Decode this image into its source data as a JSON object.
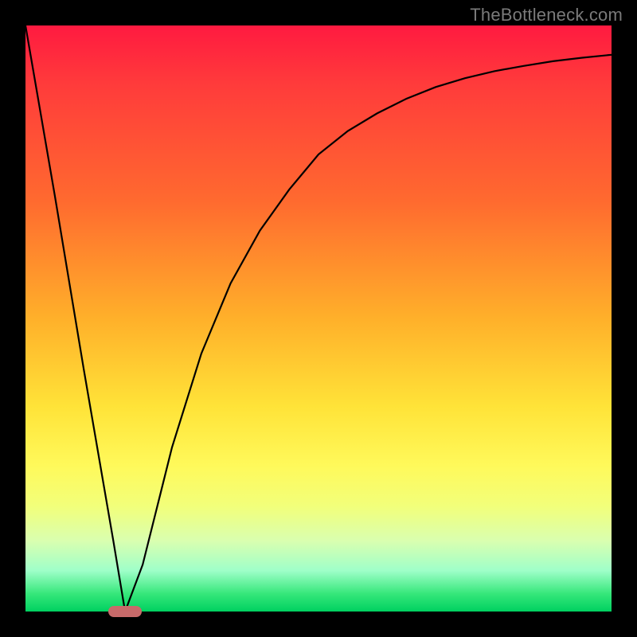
{
  "watermark": "TheBottleneck.com",
  "colors": {
    "background": "#000000",
    "gradient_top": "#ff1a40",
    "gradient_bottom": "#00d060",
    "curve": "#000000",
    "marker": "#c76a6a"
  },
  "chart_data": {
    "type": "line",
    "title": "",
    "xlabel": "",
    "ylabel": "",
    "xlim": [
      0,
      100
    ],
    "ylim": [
      0,
      100
    ],
    "grid": false,
    "series": [
      {
        "name": "bottleneck-curve",
        "x": [
          0,
          5,
          10,
          15,
          17,
          20,
          23,
          25,
          30,
          35,
          40,
          45,
          50,
          55,
          60,
          65,
          70,
          75,
          80,
          85,
          90,
          95,
          100
        ],
        "values": [
          100,
          71,
          41,
          12,
          0,
          8,
          20,
          28,
          44,
          56,
          65,
          72,
          78,
          82,
          85,
          87.5,
          89.5,
          91,
          92.2,
          93.1,
          93.9,
          94.5,
          95
        ]
      }
    ],
    "annotations": [
      {
        "name": "optimal-marker",
        "x": 17,
        "y": 0
      }
    ]
  }
}
